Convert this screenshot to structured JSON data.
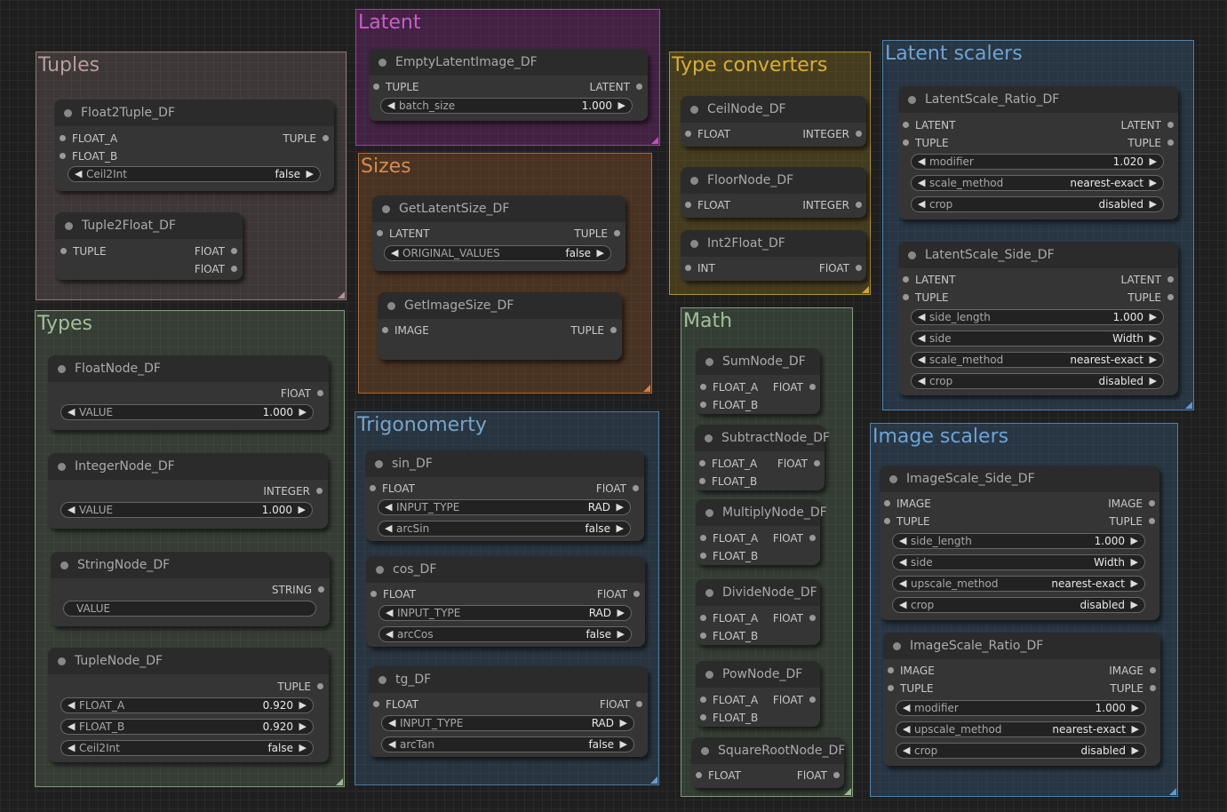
{
  "groups": {
    "tuples": {
      "title": "Tuples",
      "color": "#9a7f7f"
    },
    "types": {
      "title": "Types",
      "color": "#8aa684"
    },
    "latent": {
      "title": "Latent",
      "color": "#b44cb4"
    },
    "sizes": {
      "title": "Sizes",
      "color": "#c6773e"
    },
    "trig": {
      "title": "Trigonomerty",
      "color": "#5f8fb5"
    },
    "typeconv": {
      "title": "Type converters",
      "color": "#c9a227"
    },
    "math": {
      "title": "Math",
      "color": "#7fa27a"
    },
    "latentscalers": {
      "title": "Latent scalers",
      "color": "#5a93c4"
    },
    "imagescalers": {
      "title": "Image scalers",
      "color": "#5a93c4"
    }
  },
  "nodes": {
    "float2tuple": {
      "title": "Float2Tuple_DF",
      "in1": "FLOAT_A",
      "in2": "FLOAT_B",
      "out1": "TUPLE",
      "w1_label": "Ceil2Int",
      "w1_value": "false"
    },
    "tuple2float": {
      "title": "Tuple2Float_DF",
      "in1": "TUPLE",
      "out1": "FlOAT",
      "out2": "FlOAT"
    },
    "floatnode": {
      "title": "FloatNode_DF",
      "out1": "FlOAT",
      "w1_label": "VALUE",
      "w1_value": "1.000"
    },
    "integernode": {
      "title": "IntegerNode_DF",
      "out1": "INTEGER",
      "w1_label": "VALUE",
      "w1_value": "1.000"
    },
    "stringnode": {
      "title": "StringNode_DF",
      "out1": "STRING",
      "w1_label": "VALUE"
    },
    "tuplenode": {
      "title": "TupleNode_DF",
      "out1": "TUPLE",
      "w1_label": "FLOAT_A",
      "w1_value": "0.920",
      "w2_label": "FLOAT_B",
      "w2_value": "0.920",
      "w3_label": "Ceil2Int",
      "w3_value": "false"
    },
    "emptylatent": {
      "title": "EmptyLatentImage_DF",
      "in1": "TUPLE",
      "out1": "LATENT",
      "w1_label": "batch_size",
      "w1_value": "1.000"
    },
    "getlatentsize": {
      "title": "GetLatentSize_DF",
      "in1": "LATENT",
      "out1": "TUPLE",
      "w1_label": "ORIGINAL_VALUES",
      "w1_value": "false"
    },
    "getimagesize": {
      "title": "GetImageSize_DF",
      "in1": "IMAGE",
      "out1": "TUPLE"
    },
    "sin": {
      "title": "sin_DF",
      "in1": "FLOAT",
      "out1": "FlOAT",
      "w1_label": "INPUT_TYPE",
      "w1_value": "RAD",
      "w2_label": "arcSin",
      "w2_value": "false"
    },
    "cos": {
      "title": "cos_DF",
      "in1": "FLOAT",
      "out1": "FlOAT",
      "w1_label": "INPUT_TYPE",
      "w1_value": "RAD",
      "w2_label": "arcCos",
      "w2_value": "false"
    },
    "tg": {
      "title": "tg_DF",
      "in1": "FLOAT",
      "out1": "FlOAT",
      "w1_label": "INPUT_TYPE",
      "w1_value": "RAD",
      "w2_label": "arcTan",
      "w2_value": "false"
    },
    "ceilnode": {
      "title": "CeilNode_DF",
      "in1": "FLOAT",
      "out1": "INTEGER"
    },
    "floornode": {
      "title": "FloorNode_DF",
      "in1": "FLOAT",
      "out1": "INTEGER"
    },
    "int2float": {
      "title": "Int2Float_DF",
      "in1": "INT",
      "out1": "FlOAT"
    },
    "sumnode": {
      "title": "SumNode_DF",
      "in1": "FLOAT_A",
      "in2": "FLOAT_B",
      "out1": "FlOAT"
    },
    "subtractnode": {
      "title": "SubtractNode_DF",
      "in1": "FLOAT_A",
      "in2": "FLOAT_B",
      "out1": "FlOAT"
    },
    "multiplynode": {
      "title": "MultiplyNode_DF",
      "in1": "FLOAT_A",
      "in2": "FLOAT_B",
      "out1": "FlOAT"
    },
    "dividenode": {
      "title": "DivideNode_DF",
      "in1": "FLOAT_A",
      "in2": "FLOAT_B",
      "out1": "FlOAT"
    },
    "pownode": {
      "title": "PowNode_DF",
      "in1": "FLOAT_A",
      "in2": "FLOAT_B",
      "out1": "FlOAT"
    },
    "sqrtnode": {
      "title": "SquareRootNode_DF",
      "in1": "FLOAT",
      "out1": "FlOAT"
    },
    "latentscaleratio": {
      "title": "LatentScale_Ratio_DF",
      "in1": "LATENT",
      "in2": "TUPLE",
      "out1": "LATENT",
      "out2": "TUPLE",
      "w1_label": "modifier",
      "w1_value": "1.020",
      "w2_label": "scale_method",
      "w2_value": "nearest-exact",
      "w3_label": "crop",
      "w3_value": "disabled"
    },
    "latentscaleside": {
      "title": "LatentScale_Side_DF",
      "in1": "LATENT",
      "in2": "TUPLE",
      "out1": "LATENT",
      "out2": "TUPLE",
      "w1_label": "side_length",
      "w1_value": "1.000",
      "w2_label": "side",
      "w2_value": "Width",
      "w3_label": "scale_method",
      "w3_value": "nearest-exact",
      "w4_label": "crop",
      "w4_value": "disabled"
    },
    "imagescaleside": {
      "title": "ImageScale_Side_DF",
      "in1": "IMAGE",
      "in2": "TUPLE",
      "out1": "IMAGE",
      "out2": "TUPLE",
      "w1_label": "side_length",
      "w1_value": "1.000",
      "w2_label": "side",
      "w2_value": "Width",
      "w3_label": "upscale_method",
      "w3_value": "nearest-exact",
      "w4_label": "crop",
      "w4_value": "disabled"
    },
    "imagescaleratio": {
      "title": "ImageScale_Ratio_DF",
      "in1": "IMAGE",
      "in2": "TUPLE",
      "out1": "IMAGE",
      "out2": "TUPLE",
      "w1_label": "modifier",
      "w1_value": "1.000",
      "w2_label": "upscale_method",
      "w2_value": "nearest-exact",
      "w3_label": "crop",
      "w3_value": "disabled"
    }
  }
}
